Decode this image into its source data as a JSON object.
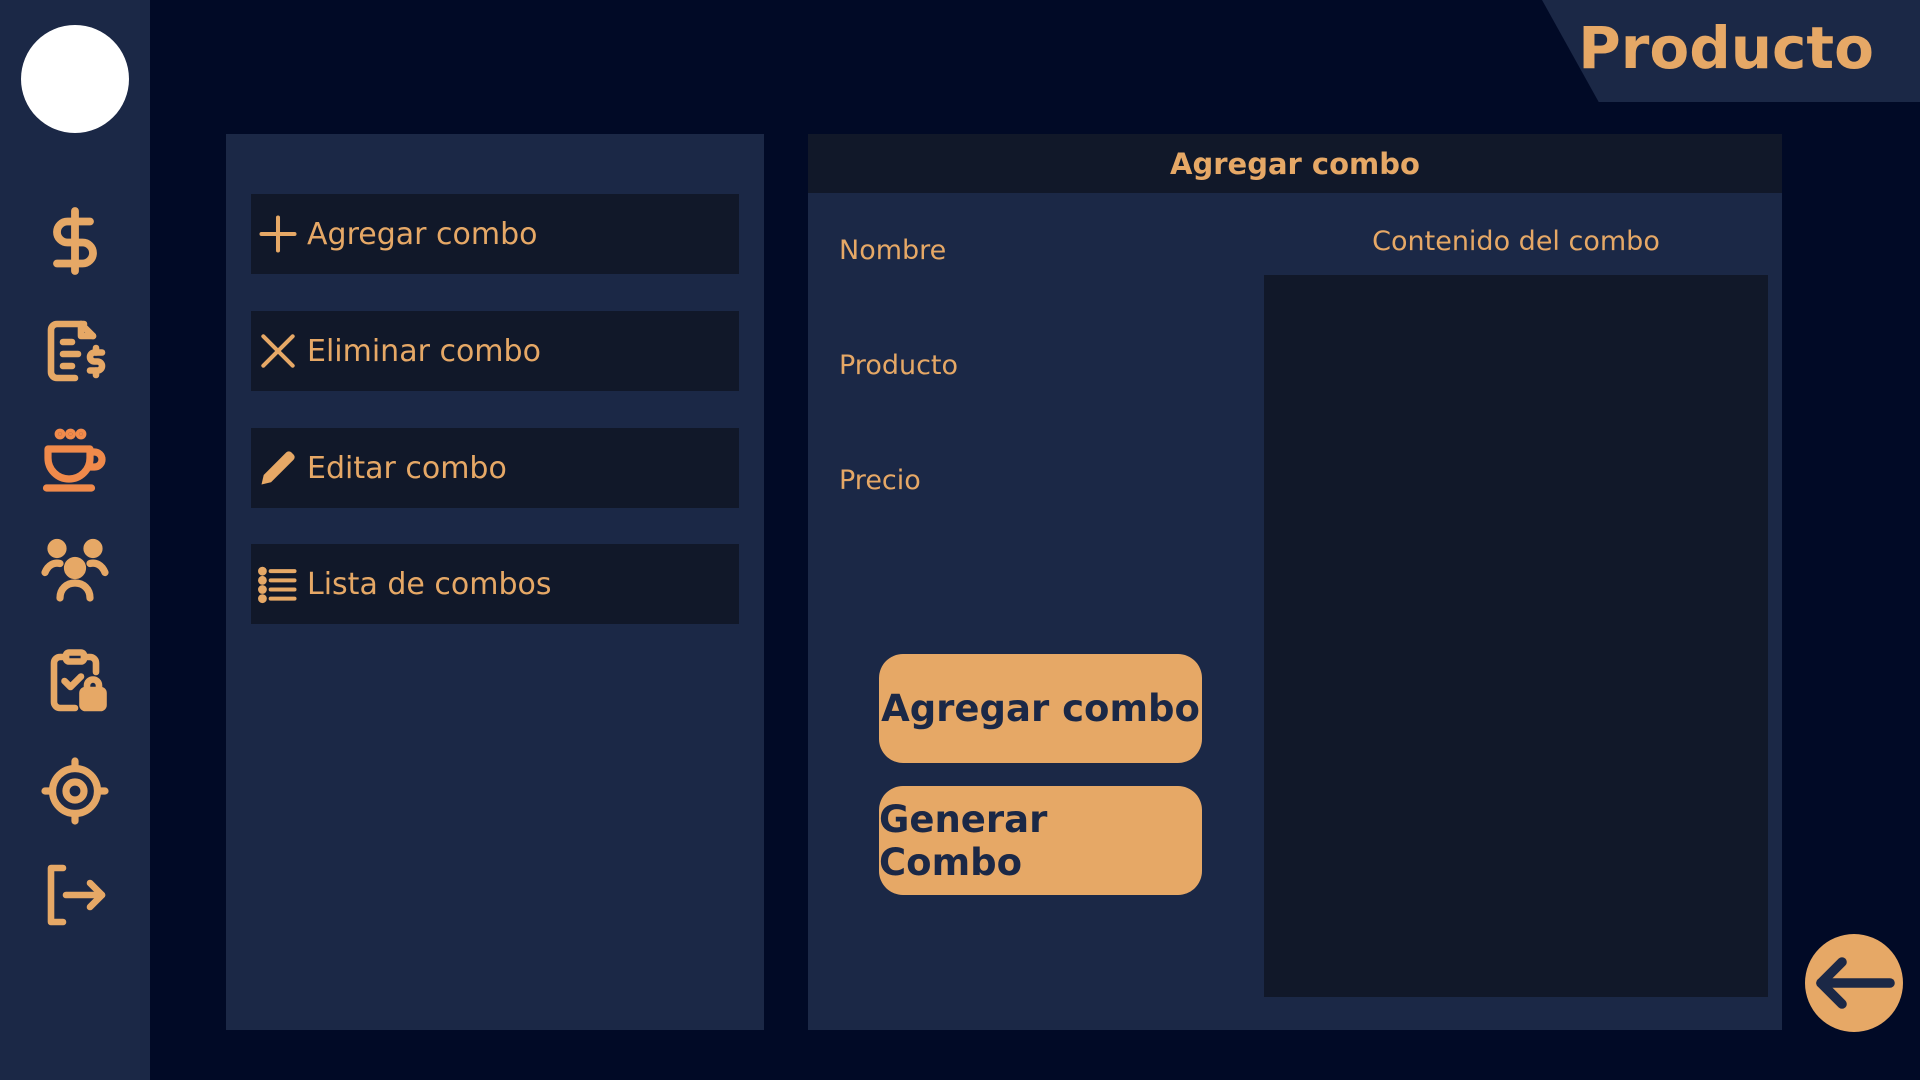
{
  "page": {
    "title": "Producto"
  },
  "sidebar": {
    "items": [
      {
        "name": "dollar-icon",
        "active": false
      },
      {
        "name": "invoice-dollar-icon",
        "active": false
      },
      {
        "name": "coffee-cup-icon",
        "active": true
      },
      {
        "name": "users-group-icon",
        "active": false
      },
      {
        "name": "clipboard-lock-icon",
        "active": false
      },
      {
        "name": "gear-icon",
        "active": false
      },
      {
        "name": "logout-icon",
        "active": false
      }
    ]
  },
  "menu": {
    "items": [
      {
        "label": "Agregar combo",
        "icon": "plus-icon"
      },
      {
        "label": "Eliminar combo",
        "icon": "close-icon"
      },
      {
        "label": "Editar combo",
        "icon": "pencil-icon"
      },
      {
        "label": "Lista de combos",
        "icon": "list-icon"
      }
    ]
  },
  "form": {
    "header": "Agregar combo",
    "fields": {
      "nombre": "Nombre",
      "producto": "Producto",
      "precio": "Precio"
    },
    "content_label": "Contenido del combo",
    "add_button": "Agregar combo",
    "generate_button": "Generar Combo"
  },
  "colors": {
    "background": "#010a26",
    "panel": "#1b2846",
    "dark": "#111829",
    "accent": "#e6a866",
    "active_icon": "#f08a4b"
  },
  "back_button": {
    "icon": "arrow-left-icon"
  }
}
